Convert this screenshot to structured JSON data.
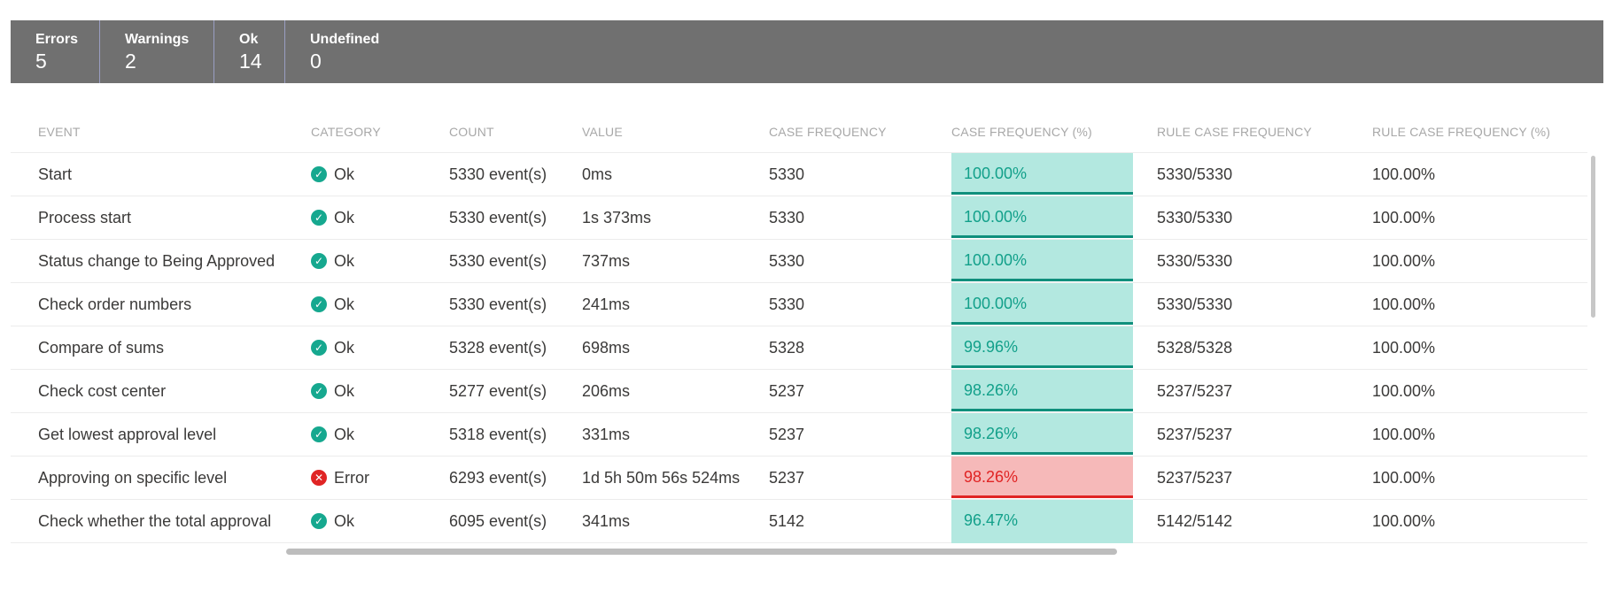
{
  "summary": [
    {
      "label": "Errors",
      "value": "5"
    },
    {
      "label": "Warnings",
      "value": "2"
    },
    {
      "label": "Ok",
      "value": "14"
    },
    {
      "label": "Undefined",
      "value": "0"
    }
  ],
  "columns": {
    "event": "EVENT",
    "category": "CATEGORY",
    "count": "COUNT",
    "value": "VALUE",
    "case_frequency": "CASE FREQUENCY",
    "case_frequency_pct": "CASE FREQUENCY (%)",
    "rule_case_frequency": "RULE CASE FREQUENCY",
    "rule_case_frequency_pct": "RULE CASE FREQUENCY (%)"
  },
  "rows": [
    {
      "event": "Start",
      "category": "Ok",
      "status": "ok",
      "count": "5330 event(s)",
      "value": "0ms",
      "case_frequency": "5330",
      "case_frequency_pct": "100.00%",
      "rule_case_frequency": "5330/5330",
      "rule_case_frequency_pct": "100.00%"
    },
    {
      "event": "Process start",
      "category": "Ok",
      "status": "ok",
      "count": "5330 event(s)",
      "value": "1s 373ms",
      "case_frequency": "5330",
      "case_frequency_pct": "100.00%",
      "rule_case_frequency": "5330/5330",
      "rule_case_frequency_pct": "100.00%"
    },
    {
      "event": "Status change to Being Approved",
      "category": "Ok",
      "status": "ok",
      "count": "5330 event(s)",
      "value": "737ms",
      "case_frequency": "5330",
      "case_frequency_pct": "100.00%",
      "rule_case_frequency": "5330/5330",
      "rule_case_frequency_pct": "100.00%"
    },
    {
      "event": "Check order numbers",
      "category": "Ok",
      "status": "ok",
      "count": "5330 event(s)",
      "value": "241ms",
      "case_frequency": "5330",
      "case_frequency_pct": "100.00%",
      "rule_case_frequency": "5330/5330",
      "rule_case_frequency_pct": "100.00%"
    },
    {
      "event": "Compare of sums",
      "category": "Ok",
      "status": "ok",
      "count": "5328 event(s)",
      "value": "698ms",
      "case_frequency": "5328",
      "case_frequency_pct": "99.96%",
      "rule_case_frequency": "5328/5328",
      "rule_case_frequency_pct": "100.00%"
    },
    {
      "event": "Check cost center",
      "category": "Ok",
      "status": "ok",
      "count": "5277 event(s)",
      "value": "206ms",
      "case_frequency": "5237",
      "case_frequency_pct": "98.26%",
      "rule_case_frequency": "5237/5237",
      "rule_case_frequency_pct": "100.00%"
    },
    {
      "event": "Get lowest approval level",
      "category": "Ok",
      "status": "ok",
      "count": "5318 event(s)",
      "value": "331ms",
      "case_frequency": "5237",
      "case_frequency_pct": "98.26%",
      "rule_case_frequency": "5237/5237",
      "rule_case_frequency_pct": "100.00%"
    },
    {
      "event": "Approving on specific level",
      "category": "Error",
      "status": "error",
      "count": "6293 event(s)",
      "value": "1d 5h 50m 56s 524ms",
      "case_frequency": "5237",
      "case_frequency_pct": "98.26%",
      "rule_case_frequency": "5237/5237",
      "rule_case_frequency_pct": "100.00%"
    },
    {
      "event": "Check whether the total approval",
      "category": "Ok",
      "status": "ok",
      "count": "6095 event(s)",
      "value": "341ms",
      "case_frequency": "5142",
      "case_frequency_pct": "96.47%",
      "rule_case_frequency": "5142/5142",
      "rule_case_frequency_pct": "100.00%"
    }
  ],
  "colors": {
    "summary_bg": "#707070",
    "ok_fill": "#b3e8e0",
    "ok_text": "#12a08a",
    "error_fill": "#f6b9b9",
    "error_text": "#e02424"
  },
  "icons": {
    "ok": "check-circle-icon",
    "error": "x-circle-icon"
  }
}
